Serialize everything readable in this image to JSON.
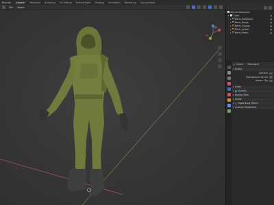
{
  "app": {
    "menu_label": "Blender"
  },
  "workspaces": [
    "Layout",
    "Modeling",
    "Sculpting",
    "UV Editing",
    "Texture Paint",
    "Shading",
    "Animation",
    "Rendering",
    "Compositing"
  ],
  "active_workspace_index": 0,
  "viewport_header": {
    "view_menu": "File",
    "select_menu": "Object"
  },
  "outliner": {
    "scene_collection": "Scene Collection",
    "collection": "Cloth",
    "items": [
      "Mens_Backback",
      "Mens_Boots",
      "Mens_Gloves",
      "Mens_Jacket",
      "Mens_Pants"
    ]
  },
  "properties": {
    "header": {
      "scene": "Scene",
      "layer": "ViewLayer"
    },
    "panel_title": "Scene",
    "rows": [
      "Camera",
      "Background Scene",
      "Active Clip"
    ],
    "sections": [
      {
        "label": "Units",
        "checkbox": false
      },
      {
        "label": "Gravity",
        "checkbox": true
      },
      {
        "label": "Keying Sets",
        "checkbox": false
      },
      {
        "label": "Audio",
        "checkbox": false
      },
      {
        "label": "Rigid Body World",
        "checkbox": false
      },
      {
        "label": "Custom Properties",
        "checkbox": false
      }
    ]
  },
  "colors": {
    "accent": "#4772b3",
    "mesh_icon": "#e39744",
    "model": "#6f7a3c",
    "axis_x": "#b0505a",
    "axis_y": "#8ba24e"
  }
}
